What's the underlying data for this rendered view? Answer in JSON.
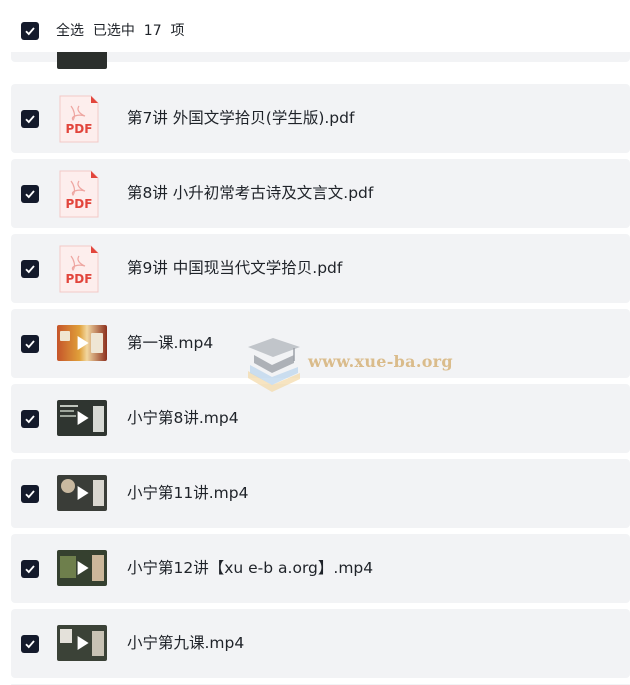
{
  "header": {
    "select_all_label": "全选  已选中  17  项"
  },
  "files": [
    {
      "name": "",
      "type": "video",
      "checked": true
    },
    {
      "name": "第7讲 外国文学拾贝(学生版).pdf",
      "type": "pdf",
      "checked": true
    },
    {
      "name": "第8讲 小升初常考古诗及文言文.pdf",
      "type": "pdf",
      "checked": true
    },
    {
      "name": "第9讲 中国现当代文学拾贝.pdf",
      "type": "pdf",
      "checked": true
    },
    {
      "name": "第一课.mp4",
      "type": "video",
      "checked": true
    },
    {
      "name": "小宁第8讲.mp4",
      "type": "video",
      "checked": true
    },
    {
      "name": "小宁第11讲.mp4",
      "type": "video",
      "checked": true
    },
    {
      "name": "小宁第12讲【xu e-b a.org】.mp4",
      "type": "video",
      "checked": true
    },
    {
      "name": "小宁第九课.mp4",
      "type": "video",
      "checked": true
    }
  ],
  "pdf_icon_text": "PDF",
  "watermark": {
    "text": "www.xue-ba.org"
  },
  "colors": {
    "checkbox": "#141a2b",
    "row_bg": "#f2f3f5",
    "pdf_red": "#e2453c"
  }
}
